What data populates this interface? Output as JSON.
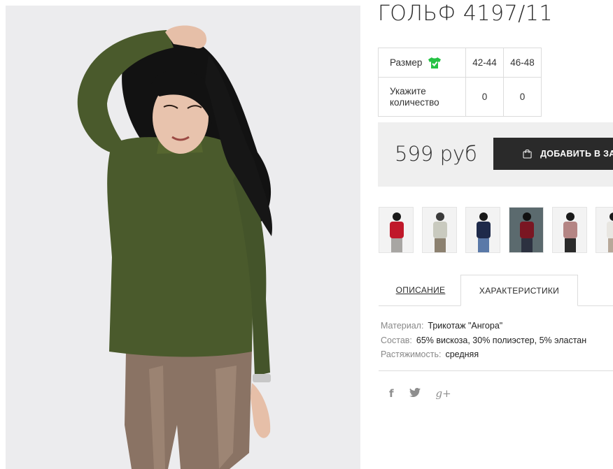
{
  "product": {
    "title": "ГОЛЬФ 4197/11",
    "price": "599 руб",
    "add_to_cart": "ДОБАВИТЬ В ЗАКАЗ"
  },
  "size_table": {
    "size_label": "Размер",
    "qty_label_line1": "Укажите",
    "qty_label_line2": "количество",
    "sizes": [
      "42-44",
      "46-48"
    ],
    "quantities": [
      "0",
      "0"
    ]
  },
  "thumbnails": [
    {
      "color": "red",
      "name": "thumbnail-red"
    },
    {
      "color": "olive",
      "name": "thumbnail-olive"
    },
    {
      "color": "navy",
      "name": "thumbnail-navy"
    },
    {
      "color": "burgundy",
      "name": "thumbnail-burgundy"
    },
    {
      "color": "pink",
      "name": "thumbnail-pink"
    },
    {
      "color": "white",
      "name": "thumbnail-white"
    }
  ],
  "tabs": {
    "description": "ОПИСАНИЕ",
    "characteristics": "ХАРАКТЕРИСТИКИ"
  },
  "specs": {
    "material_key": "Материал:",
    "material_val": "Трикотаж \"Ангора\"",
    "composition_key": "Состав:",
    "composition_val": "65% вискоза, 30% полиэстер, 5% эластан",
    "stretch_key": "Растяжимость:",
    "stretch_val": "средняя"
  },
  "social": {
    "facebook": "f",
    "twitter": "🐦",
    "google": "g+"
  },
  "colors": {
    "accent_green": "#25c244",
    "button_dark": "#2a2a2a",
    "price_bg": "#efefef",
    "sweater_olive": "#4a5a2c",
    "pants_leather": "#8a7364"
  }
}
